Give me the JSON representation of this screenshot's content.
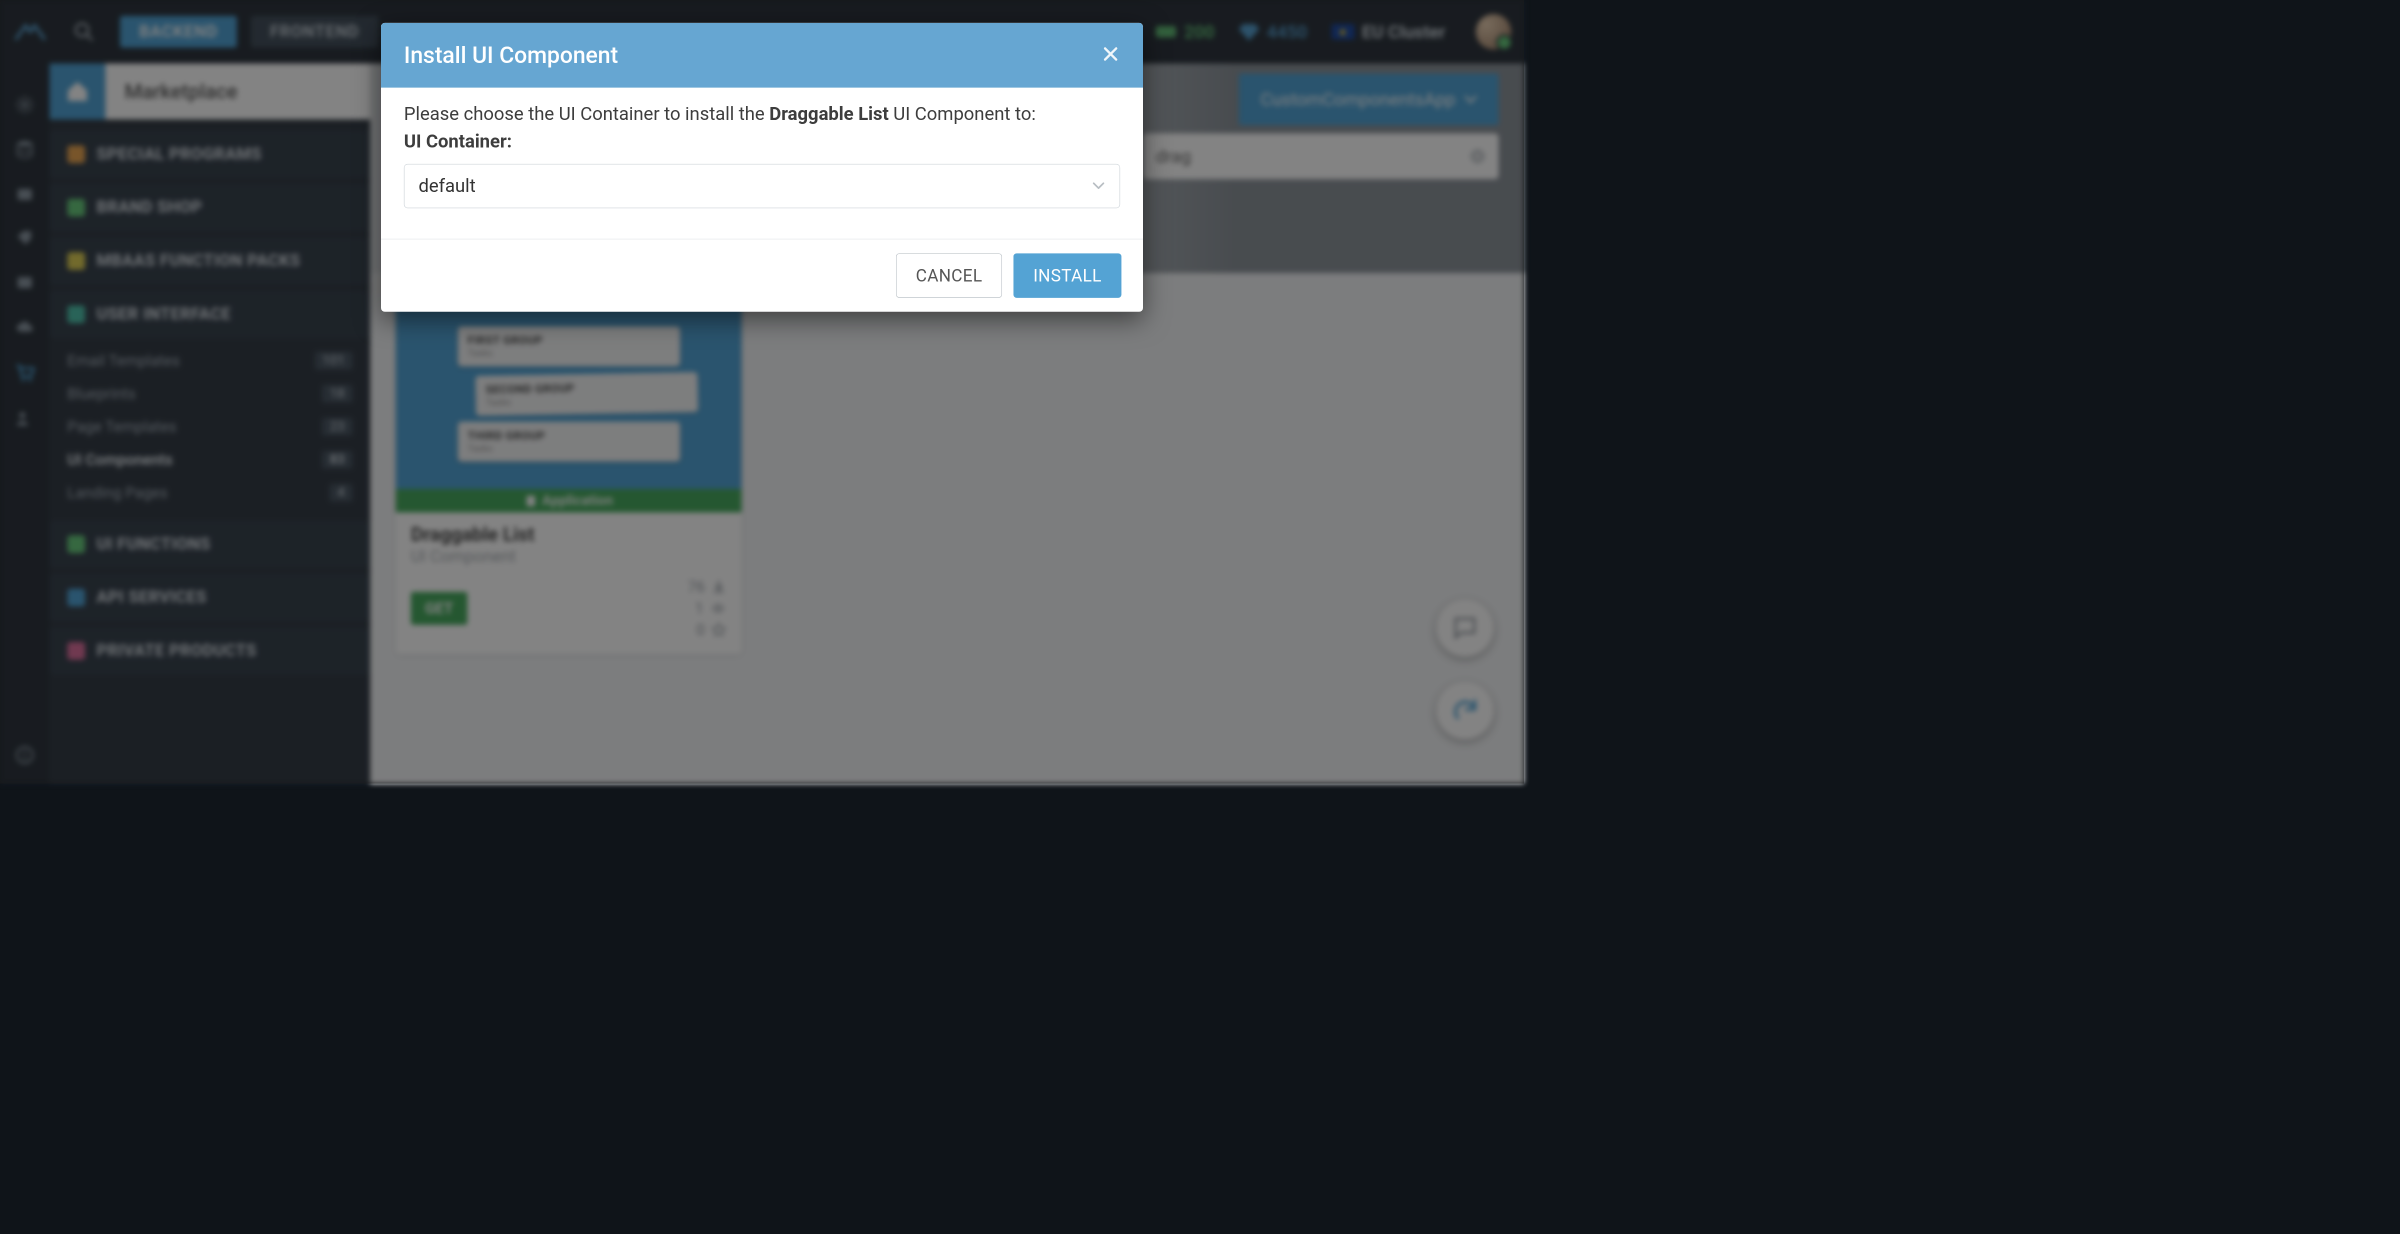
{
  "topbar": {
    "tabs": {
      "backend": "BACKEND",
      "frontend": "FRONTEND"
    },
    "stats": {
      "credits": "200",
      "points": "4450",
      "cluster": "EU Cluster"
    }
  },
  "breadcrumb": {
    "title": "Marketplace"
  },
  "app_selector": {
    "label": "CustomComponentsApp"
  },
  "search": {
    "value": "drag"
  },
  "sidebar": {
    "sections": [
      {
        "label": "SPECIAL PROGRAMS"
      },
      {
        "label": "BRAND SHOP"
      },
      {
        "label": "MBAAS FUNCTION PACKS"
      },
      {
        "label": "USER INTERFACE"
      },
      {
        "label": "UI FUNCTIONS"
      },
      {
        "label": "API SERVICES"
      },
      {
        "label": "PRIVATE PRODUCTS"
      }
    ],
    "ui_items": [
      {
        "label": "Email Templates",
        "count": "101"
      },
      {
        "label": "Blueprints",
        "count": "18"
      },
      {
        "label": "Page Templates",
        "count": "23"
      },
      {
        "label": "UI Components",
        "count": "83"
      },
      {
        "label": "Landing Pages",
        "count": "4"
      }
    ]
  },
  "card": {
    "ribbon": "Application",
    "title": "Draggable List",
    "subtitle": "UI Component",
    "downloads": "76",
    "views": "1",
    "stars": "0",
    "get": "GET",
    "preview": {
      "g1": "FIRST GROUP",
      "g2": "SECOND GROUP",
      "g3": "THIRD GROUP",
      "sub": "Tasks"
    }
  },
  "modal": {
    "title": "Install UI Component",
    "prompt_pre": "Please choose the UI Container to install the ",
    "prompt_bold": "Draggable List",
    "prompt_post": " UI Component to:",
    "field_label": "UI Container:",
    "selected": "default",
    "cancel": "CANCEL",
    "install": "INSTALL"
  }
}
